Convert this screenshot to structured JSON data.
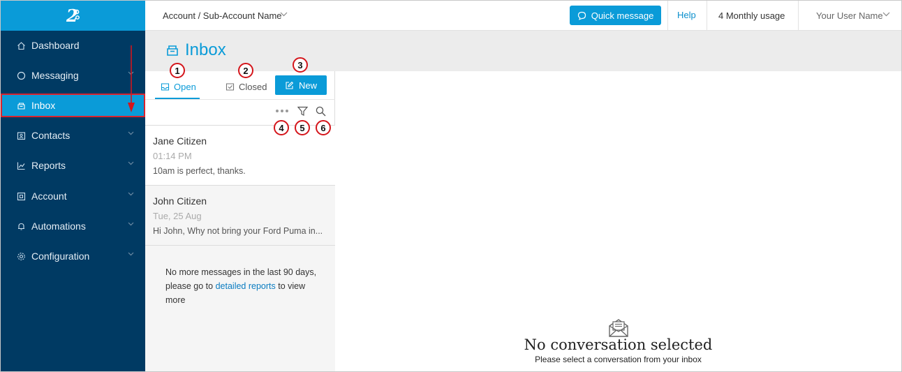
{
  "sidebar": {
    "logo": "2",
    "items": [
      {
        "label": "Dashboard",
        "icon": "home-icon",
        "has_chevron": false
      },
      {
        "label": "Messaging",
        "icon": "circle-icon",
        "has_chevron": true
      },
      {
        "label": "Inbox",
        "icon": "inbox-icon",
        "has_chevron": false,
        "active": true
      },
      {
        "label": "Contacts",
        "icon": "contacts-icon",
        "has_chevron": true
      },
      {
        "label": "Reports",
        "icon": "chart-icon",
        "has_chevron": true
      },
      {
        "label": "Account",
        "icon": "account-icon",
        "has_chevron": true
      },
      {
        "label": "Automations",
        "icon": "bell-icon",
        "has_chevron": true
      },
      {
        "label": "Configuration",
        "icon": "gear-icon",
        "has_chevron": true
      }
    ]
  },
  "header": {
    "account": "Account / Sub-Account Name",
    "quick_message": "Quick message",
    "help": "Help",
    "usage": "4 Monthly usage",
    "user": "Your User Name"
  },
  "page": {
    "title": "Inbox"
  },
  "inbox": {
    "tabs": {
      "open": "Open",
      "closed": "Closed"
    },
    "new_button": "New",
    "messages": [
      {
        "name": "Jane Citizen",
        "time": "01:14 PM",
        "snippet": "10am is perfect, thanks."
      },
      {
        "name": "John Citizen",
        "time": "Tue, 25 Aug",
        "snippet": "Hi John, Why not bring your Ford Puma in..."
      }
    ],
    "end_note_before": "No more messages in the last 90 days, please go to ",
    "end_note_link": "detailed reports",
    "end_note_after": " to view more"
  },
  "conversation": {
    "empty_title": "No conversation selected",
    "empty_subtitle": "Please select a conversation from your inbox"
  },
  "annotations": [
    "1",
    "2",
    "3",
    "4",
    "5",
    "6"
  ],
  "colors": {
    "brand": "#0a9bd8",
    "sidebar": "#003a63",
    "annotation": "#d4151b"
  }
}
